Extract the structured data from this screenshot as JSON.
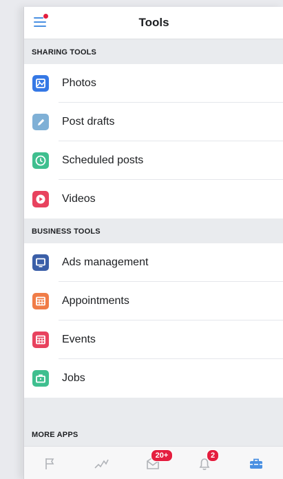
{
  "header": {
    "title": "Tools"
  },
  "sections": {
    "sharing": {
      "title": "SHARING TOOLS",
      "items": [
        {
          "label": "Photos",
          "icon": "photos-icon",
          "color": "#3578e5"
        },
        {
          "label": "Post drafts",
          "icon": "pencil-icon",
          "color": "#7fb0d6"
        },
        {
          "label": "Scheduled posts",
          "icon": "clock-icon",
          "color": "#3fbf8f"
        },
        {
          "label": "Videos",
          "icon": "play-icon",
          "color": "#e8425e"
        }
      ]
    },
    "business": {
      "title": "BUSINESS TOOLS",
      "items": [
        {
          "label": "Ads management",
          "icon": "monitor-icon",
          "color": "#3b5fa8"
        },
        {
          "label": "Appointments",
          "icon": "calendar-icon",
          "color": "#f07c47"
        },
        {
          "label": "Events",
          "icon": "calendar-icon",
          "color": "#e8425e"
        },
        {
          "label": "Jobs",
          "icon": "briefcase-icon",
          "color": "#3fbf8f"
        }
      ]
    },
    "more": {
      "title": "MORE APPS"
    }
  },
  "tabbar": {
    "tabs": [
      {
        "name": "pages-tab",
        "icon": "flag-icon"
      },
      {
        "name": "insights-tab",
        "icon": "insights-icon"
      },
      {
        "name": "inbox-tab",
        "icon": "inbox-icon",
        "badge": "20+"
      },
      {
        "name": "notifications-tab",
        "icon": "bell-icon",
        "badge": "2"
      },
      {
        "name": "tools-tab",
        "icon": "toolbox-icon",
        "active": true
      }
    ]
  },
  "colors": {
    "accent": "#4a90e2",
    "badge": "#e41e3f",
    "section_bg": "#e9ebee"
  }
}
